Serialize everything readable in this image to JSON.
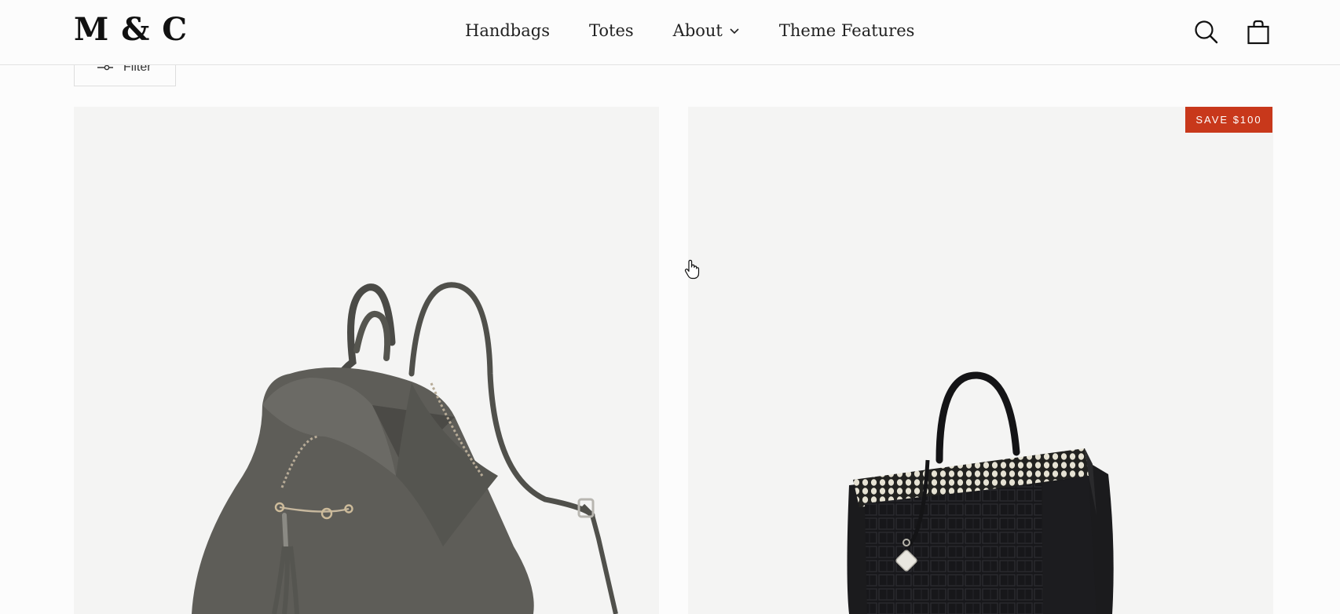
{
  "header": {
    "logo": "M & C",
    "nav": {
      "handbags": "Handbags",
      "totes": "Totes",
      "about": "About",
      "theme_features": "Theme Features"
    }
  },
  "filter": {
    "label": "Filter"
  },
  "products": [
    {
      "image_alt": "Grey leather backpack"
    },
    {
      "image_alt": "Black croc tote bag",
      "badge": "SAVE $100"
    }
  ],
  "colors": {
    "accent_badge": "#c8381b",
    "card_bg": "#f4f4f3",
    "page_bg": "#fcfcfc"
  },
  "icons": [
    "search-icon",
    "cart-icon",
    "chevron-down-icon",
    "filter-icon"
  ]
}
